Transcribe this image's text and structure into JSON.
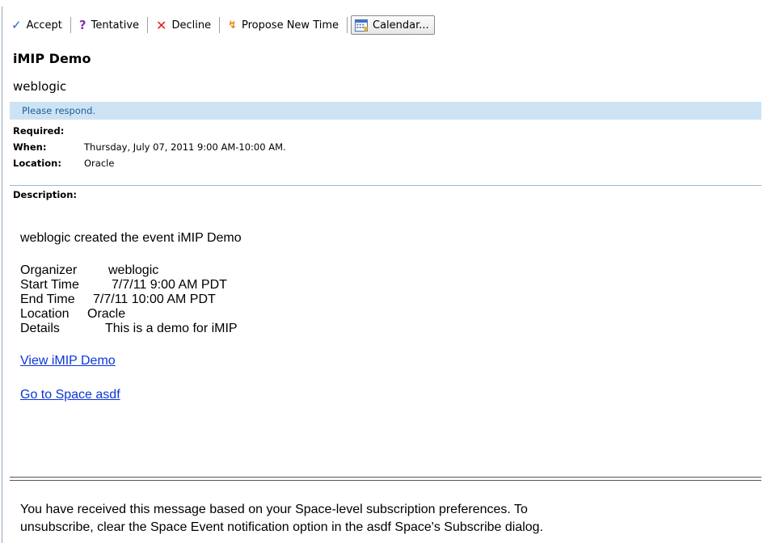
{
  "toolbar": {
    "accept": "Accept",
    "tentative": "Tentative",
    "decline": "Decline",
    "propose": "Propose New Time",
    "calendar": "Calendar..."
  },
  "message": {
    "title": "iMIP Demo",
    "sender": "weblogic",
    "banner": "Please respond."
  },
  "meta": {
    "required_label": "Required:",
    "when_label": "When:",
    "when_value": "Thursday, July 07, 2011 9:00 AM-10:00 AM.",
    "location_label": "Location:",
    "location_value": "Oracle",
    "description_label": "Description:"
  },
  "body": {
    "intro": "weblogic created the event iMIP Demo",
    "organizer_label": "Organizer",
    "organizer_value": "weblogic",
    "start_label": "Start Time",
    "start_value": "7/7/11 9:00 AM PDT",
    "end_label": "End Time",
    "end_value": "7/7/11 10:00 AM PDT",
    "location_label": "Location",
    "location_value": "Oracle",
    "details_label": "Details",
    "details_value": "This is a demo for iMIP",
    "link_view": "View iMIP Demo",
    "link_space": "Go to Space asdf"
  },
  "footer": {
    "line1": "You have received this message based on your Space-level subscription preferences. To",
    "line2": "unsubscribe, clear the Space Event notification option in the asdf Space's Subscribe dialog."
  }
}
